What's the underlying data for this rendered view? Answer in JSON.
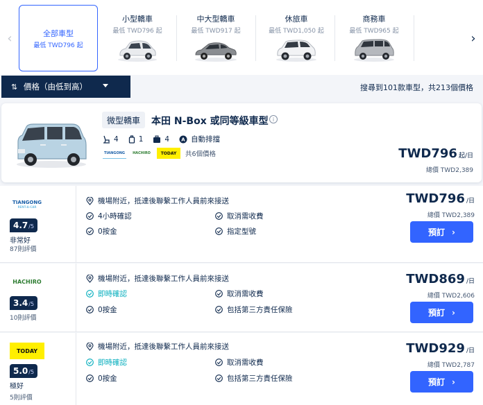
{
  "categories": [
    {
      "name": "全部車型",
      "price": "最低 TWD796 起"
    },
    {
      "name": "小型轎車",
      "price": "最低 TWD796 起"
    },
    {
      "name": "中大型轎車",
      "price": "最低 TWD917 起"
    },
    {
      "name": "休旅車",
      "price": "最低 TWD1,050 起"
    },
    {
      "name": "商務車",
      "price": "最低 TWD965 起"
    }
  ],
  "sort": {
    "label": "價格（由低到高）",
    "icon": "sort-icon"
  },
  "results_text": "搜尋到101款車型，共213個價格",
  "car": {
    "class": "微型轎車",
    "title": "本田 N-Box 或同等級車型",
    "specs": {
      "seats": "4",
      "doors": "1",
      "luggage": "4",
      "transmission": "自動排擋"
    },
    "vendors": [
      "TIANGONG",
      "HACHIRO",
      "TODAY"
    ],
    "vendor_count": "共6個價格",
    "price": "TWD796",
    "price_unit": "起/日",
    "total": "總價 TWD2,389"
  },
  "offers": [
    {
      "vendor": "TIANGONG",
      "vendor_sub": "RENT-A-CAR",
      "score": "4.7",
      "max": "/5",
      "rating_label": "非常好",
      "reviews": "87則評價",
      "pickup": "機場附近，抵達後聯繫工作人員前來接送",
      "f1": "4小時確認",
      "f2": "取消需收費",
      "f3": "0按金",
      "f4": "指定型號",
      "price": "TWD796",
      "unit": "/日",
      "total": "總價 TWD2,389",
      "book": "預訂"
    },
    {
      "vendor": "HACHIRO",
      "score": "3.4",
      "max": "/5",
      "rating_label": "",
      "reviews": "10則評價",
      "pickup": "機場附近，抵達後聯繫工作人員前來接送",
      "f1": "即時確認",
      "f2": "取消需收費",
      "f3": "0按金",
      "f4": "包括第三方責任保險",
      "price": "TWD869",
      "unit": "/日",
      "total": "總價 TWD2,606",
      "book": "預訂"
    },
    {
      "vendor": "TODAY",
      "score": "5.0",
      "max": "/5",
      "rating_label": "極好",
      "reviews": "5則評價",
      "pickup": "機場附近，抵達後聯繫工作人員前來接送",
      "f1": "即時確認",
      "f2": "取消需收費",
      "f3": "0按金",
      "f4": "包括第三方責任保險",
      "price": "TWD929",
      "unit": "/日",
      "total": "總價 TWD2,787",
      "book": "預訂"
    }
  ],
  "colors": {
    "accent": "#3264ff",
    "navy": "#0f294d",
    "green": "#06aebd",
    "today_yellow": "#ffef00"
  }
}
